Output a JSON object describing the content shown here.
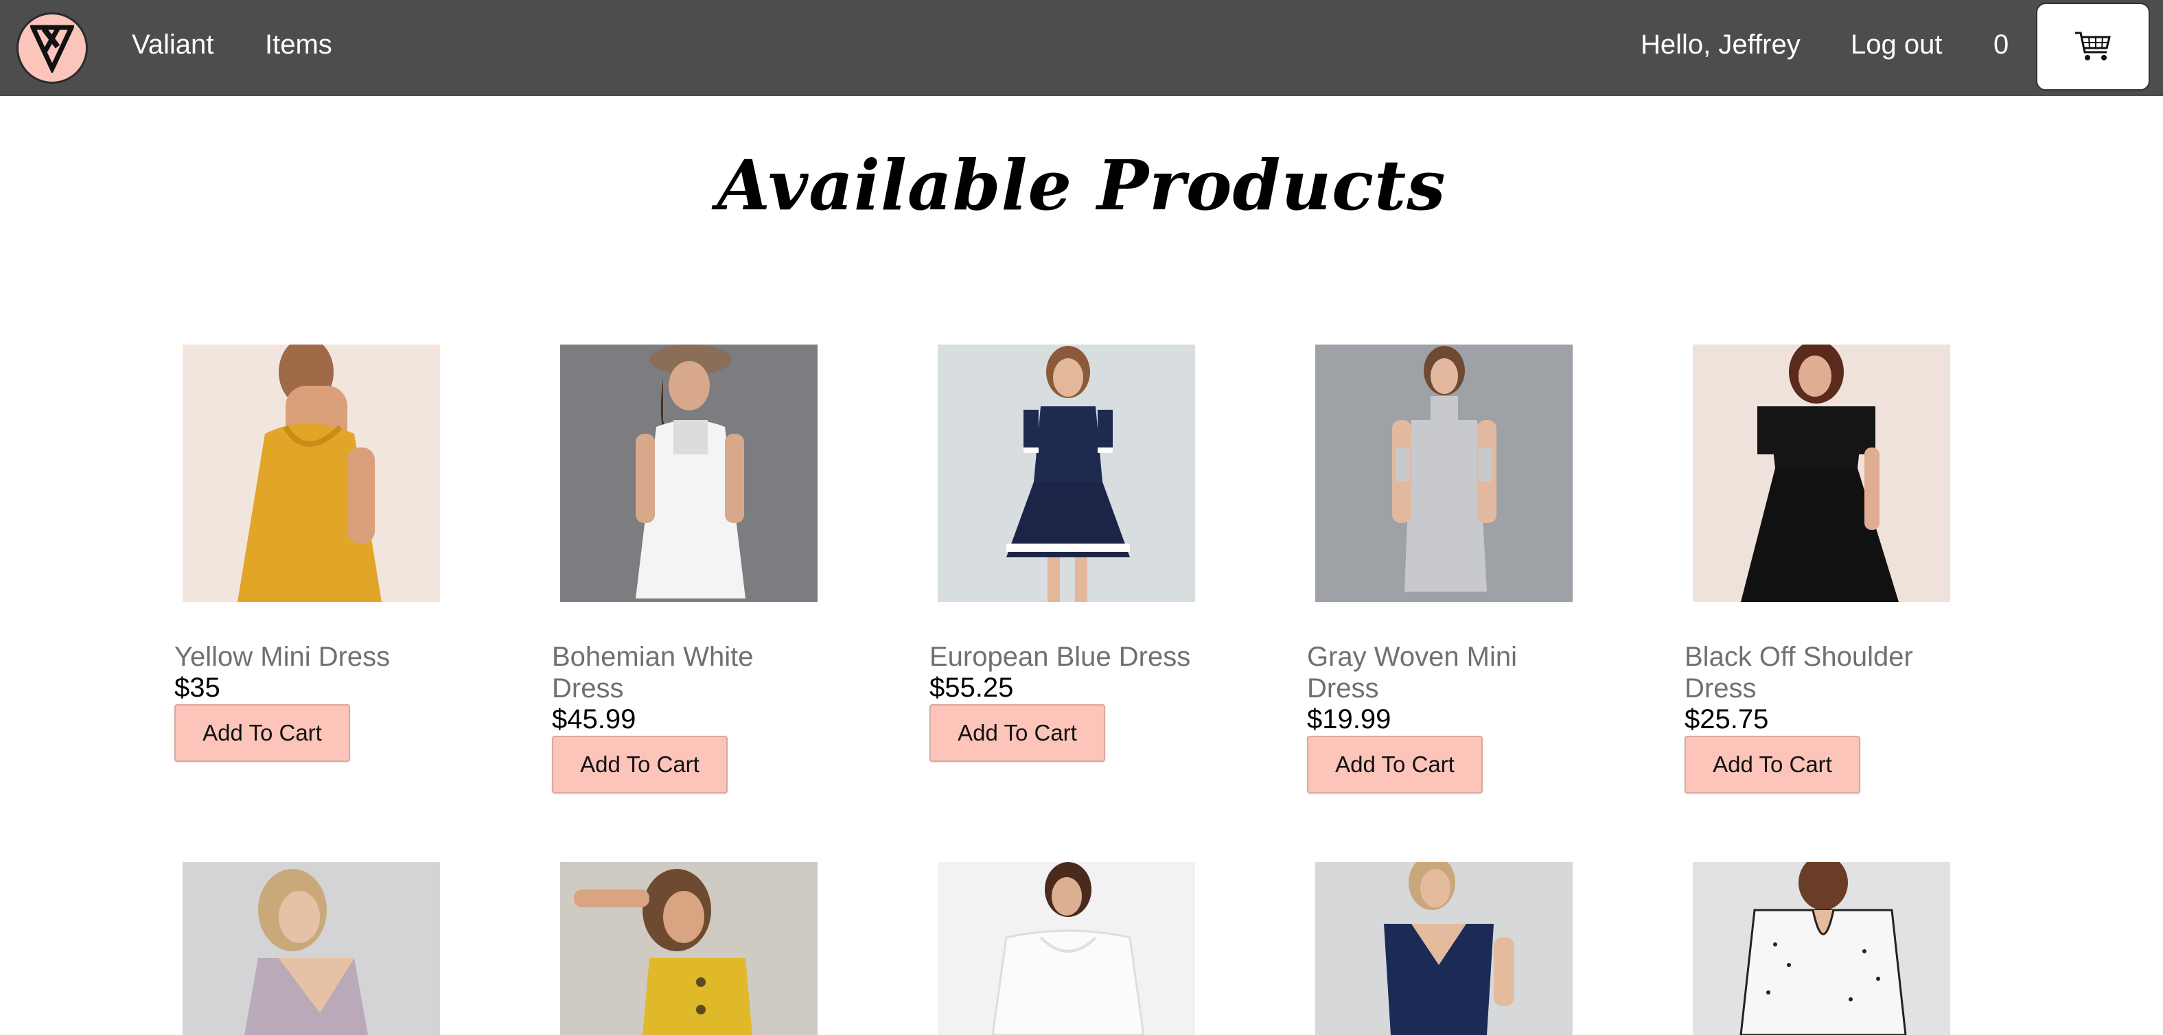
{
  "nav": {
    "brand": "Valiant",
    "items_link": "Items",
    "greeting": "Hello, Jeffrey",
    "logout": "Log out",
    "cart_count": "0"
  },
  "page": {
    "title": "Available Products"
  },
  "products": [
    {
      "name": "Yellow Mini Dress",
      "price": "$35",
      "button": "Add To Cart",
      "image": "yellow-mini-dress-photo"
    },
    {
      "name": "Bohemian White Dress",
      "price": "$45.99",
      "button": "Add To Cart",
      "image": "bohemian-white-dress-photo"
    },
    {
      "name": "European Blue Dress",
      "price": "$55.25",
      "button": "Add To Cart",
      "image": "european-blue-dress-photo"
    },
    {
      "name": "Gray Woven Mini Dress",
      "price": "$19.99",
      "button": "Add To Cart",
      "image": "gray-woven-mini-dress-photo"
    },
    {
      "name": "Black Off Shoulder Dress",
      "price": "$25.75",
      "button": "Add To Cart",
      "image": "black-off-shoulder-dress-photo"
    }
  ],
  "colors": {
    "navbar": "#4d4d4d",
    "logo_bg": "#fcc5bc",
    "button_bg": "#fdc4ba",
    "product_name": "#707070"
  },
  "icons": {
    "logo": "valiant-v-logo-icon",
    "cart": "shopping-cart-icon"
  }
}
